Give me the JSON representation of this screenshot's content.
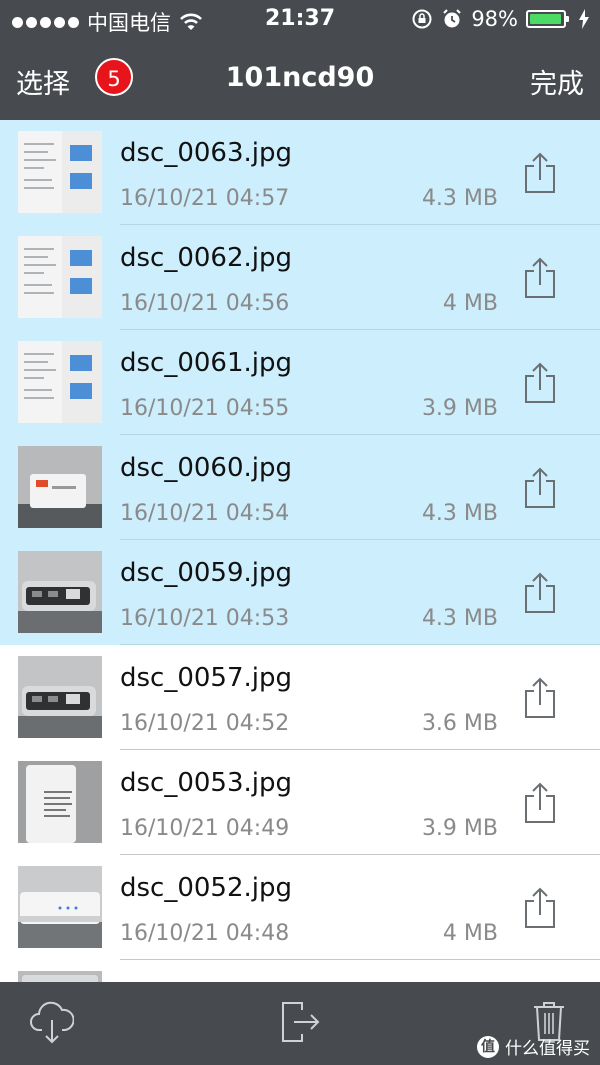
{
  "status_bar": {
    "carrier": "中国电信",
    "time": "21:37",
    "battery": "98%",
    "battery_level": 0.98,
    "icons": [
      "signal-dots-icon",
      "wifi-icon",
      "rotation-lock-icon",
      "alarm-icon",
      "battery-icon",
      "charging-bolt-icon"
    ]
  },
  "nav": {
    "select_label": "选择",
    "badge_count": "5",
    "title": "101ncd90",
    "done_label": "完成"
  },
  "files": [
    {
      "name": "dsc_0063.jpg",
      "date": "16/10/21 04:57",
      "size": "4.3 MB",
      "selected": true,
      "thumb": "document"
    },
    {
      "name": "dsc_0062.jpg",
      "date": "16/10/21 04:56",
      "size": "4 MB",
      "selected": true,
      "thumb": "document"
    },
    {
      "name": "dsc_0061.jpg",
      "date": "16/10/21 04:55",
      "size": "3.9 MB",
      "selected": true,
      "thumb": "document"
    },
    {
      "name": "dsc_0060.jpg",
      "date": "16/10/21 04:54",
      "size": "4.3 MB",
      "selected": true,
      "thumb": "device-white"
    },
    {
      "name": "dsc_0059.jpg",
      "date": "16/10/21 04:53",
      "size": "4.3 MB",
      "selected": true,
      "thumb": "device-silver"
    },
    {
      "name": "dsc_0057.jpg",
      "date": "16/10/21 04:52",
      "size": "3.6 MB",
      "selected": false,
      "thumb": "device-silver"
    },
    {
      "name": "dsc_0053.jpg",
      "date": "16/10/21 04:49",
      "size": "3.9 MB",
      "selected": false,
      "thumb": "device-label"
    },
    {
      "name": "dsc_0052.jpg",
      "date": "16/10/21 04:48",
      "size": "4 MB",
      "selected": false,
      "thumb": "device-white-side"
    },
    {
      "name": "",
      "date": "",
      "size": "",
      "selected": false,
      "thumb": "device-partial"
    }
  ],
  "toolbar": {
    "icons": [
      "cloud-download-icon",
      "export-icon",
      "trash-icon"
    ]
  },
  "watermark": {
    "text": "什么值得买",
    "mark": "值"
  },
  "colors": {
    "bar_bg": "#474b4f",
    "selected_row": "#cdeefc",
    "badge": "#e8141b",
    "battery_fill": "#4cd964"
  }
}
